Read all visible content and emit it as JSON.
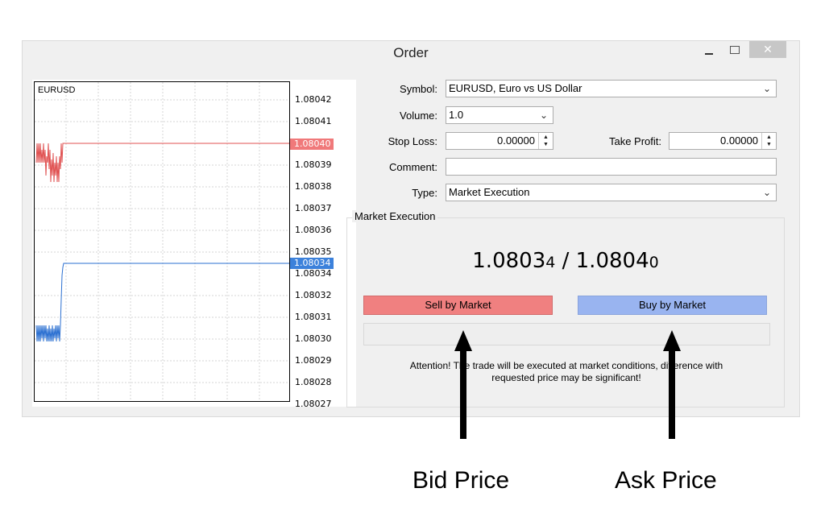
{
  "window": {
    "title": "Order",
    "close_glyph": "✕",
    "icons": [
      "minimize-icon",
      "maximize-icon",
      "close-icon"
    ]
  },
  "chart": {
    "symbol": "EURUSD",
    "y_ticks": [
      "1.08042",
      "1.08041",
      "1.08039",
      "1.08038",
      "1.08037",
      "1.08036",
      "1.08035",
      "1.08034",
      "1.08032",
      "1.08031",
      "1.08030",
      "1.08029",
      "1.08028",
      "1.08027"
    ],
    "ask_tag": "1.08040",
    "bid_tag": "1.08034",
    "colors": {
      "ask": "#f0797a",
      "bid": "#3c81db"
    }
  },
  "form": {
    "symbol_label": "Symbol:",
    "symbol_value": "EURUSD, Euro vs US Dollar",
    "volume_label": "Volume:",
    "volume_value": "1.0",
    "stop_loss_label": "Stop Loss:",
    "stop_loss_value": "0.00000",
    "take_profit_label": "Take Profit:",
    "take_profit_value": "0.00000",
    "comment_label": "Comment:",
    "comment_value": "",
    "type_label": "Type:",
    "type_value": "Market Execution"
  },
  "execution": {
    "group_title": "Market Execution",
    "bid_main": "1.0803",
    "bid_small": "4",
    "separator": " / ",
    "ask_main": "1.0804",
    "ask_small": "0",
    "sell_label": "Sell by Market",
    "buy_label": "Buy by Market",
    "attention_line1": "Attention! The trade will be executed at market conditions, difference with",
    "attention_line2": "requested price may be significant!",
    "colors": {
      "sell": "#f08080",
      "buy": "#99b4f0"
    }
  },
  "annotations": {
    "bid_label": "Bid Price",
    "ask_label": "Ask Price"
  }
}
